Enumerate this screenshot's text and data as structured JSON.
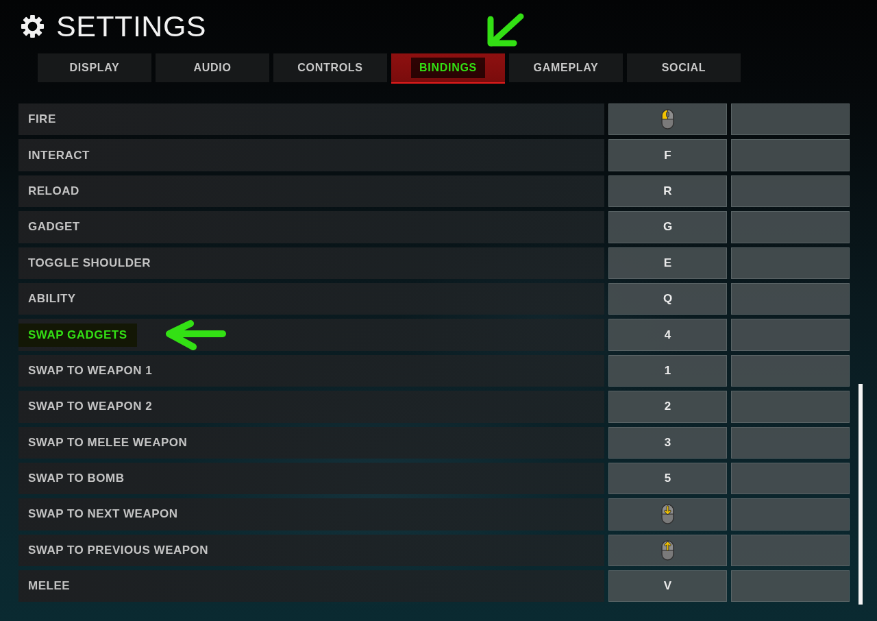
{
  "header": {
    "title": "SETTINGS"
  },
  "tabs": [
    {
      "label": "DISPLAY",
      "selected": false,
      "highlighted": false
    },
    {
      "label": "AUDIO",
      "selected": false,
      "highlighted": false
    },
    {
      "label": "CONTROLS",
      "selected": false,
      "highlighted": false
    },
    {
      "label": "BINDINGS",
      "selected": true,
      "highlighted": true
    },
    {
      "label": "GAMEPLAY",
      "selected": false,
      "highlighted": false
    },
    {
      "label": "SOCIAL",
      "selected": false,
      "highlighted": false
    }
  ],
  "bindings": [
    {
      "action": "FIRE",
      "highlighted": false,
      "primary": {
        "kind": "left-click"
      }
    },
    {
      "action": "INTERACT",
      "highlighted": false,
      "primary": {
        "kind": "key",
        "label": "F"
      }
    },
    {
      "action": "RELOAD",
      "highlighted": false,
      "primary": {
        "kind": "key",
        "label": "R"
      }
    },
    {
      "action": "GADGET",
      "highlighted": false,
      "primary": {
        "kind": "key",
        "label": "G"
      }
    },
    {
      "action": "TOGGLE SHOULDER",
      "highlighted": false,
      "primary": {
        "kind": "key",
        "label": "E"
      }
    },
    {
      "action": "ABILITY",
      "highlighted": false,
      "primary": {
        "kind": "key",
        "label": "Q"
      }
    },
    {
      "action": "SWAP GADGETS",
      "highlighted": true,
      "primary": {
        "kind": "key",
        "label": "4"
      }
    },
    {
      "action": "SWAP TO WEAPON 1",
      "highlighted": false,
      "primary": {
        "kind": "key",
        "label": "1"
      }
    },
    {
      "action": "SWAP TO WEAPON 2",
      "highlighted": false,
      "primary": {
        "kind": "key",
        "label": "2"
      }
    },
    {
      "action": "SWAP TO MELEE WEAPON",
      "highlighted": false,
      "primary": {
        "kind": "key",
        "label": "3"
      }
    },
    {
      "action": "SWAP TO BOMB",
      "highlighted": false,
      "primary": {
        "kind": "key",
        "label": "5"
      }
    },
    {
      "action": "SWAP TO NEXT WEAPON",
      "highlighted": false,
      "primary": {
        "kind": "wheel-down"
      }
    },
    {
      "action": "SWAP TO PREVIOUS WEAPON",
      "highlighted": false,
      "primary": {
        "kind": "wheel-up"
      }
    },
    {
      "action": "MELEE",
      "highlighted": false,
      "primary": {
        "kind": "key",
        "label": "V"
      }
    }
  ]
}
